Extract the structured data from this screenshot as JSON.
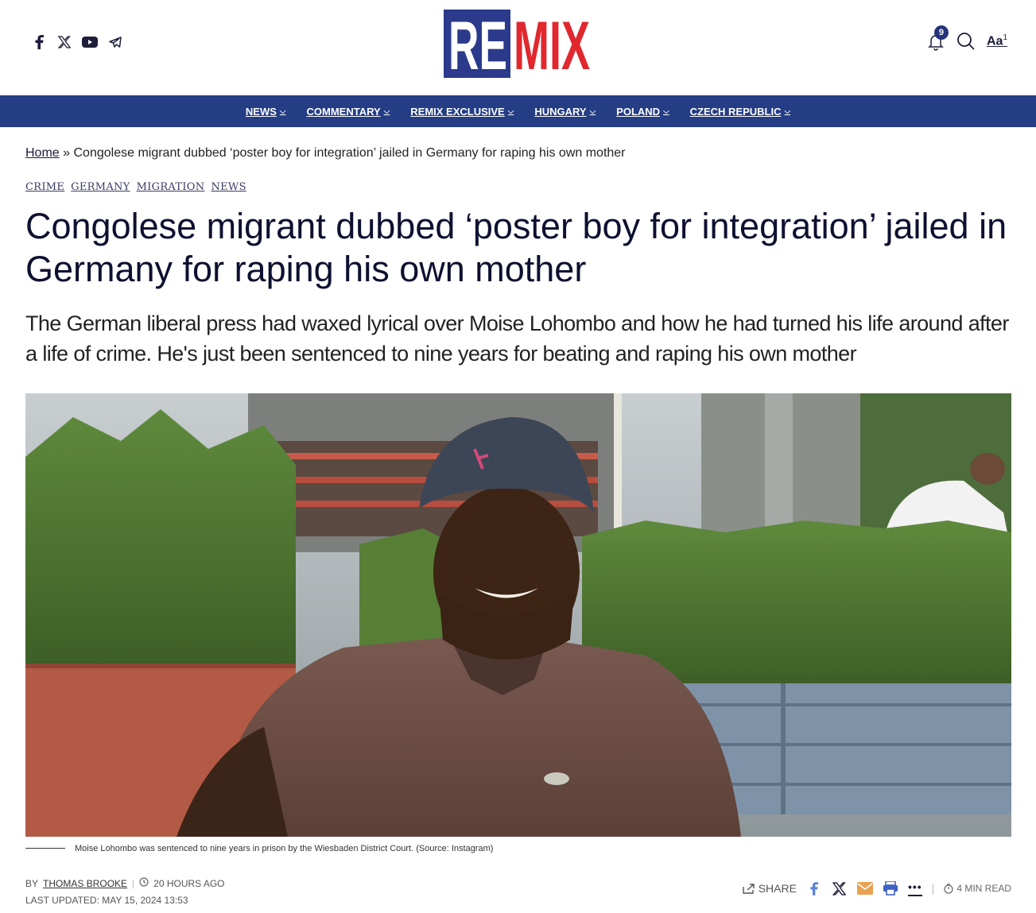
{
  "header": {
    "logo_left": "RE",
    "logo_right": "MIX",
    "notification_count": "9",
    "font_size_label": "Aa",
    "font_size_sup": "1"
  },
  "nav": [
    {
      "label": "NEWS"
    },
    {
      "label": "COMMENTARY"
    },
    {
      "label": "REMIX EXCLUSIVE"
    },
    {
      "label": "HUNGARY"
    },
    {
      "label": "POLAND"
    },
    {
      "label": "CZECH REPUBLIC"
    }
  ],
  "breadcrumb": {
    "home": "Home",
    "separator": "»",
    "current": "Congolese migrant dubbed ‘poster boy for integration’ jailed in Germany for raping his own mother"
  },
  "categories": [
    "CRIME",
    "GERMANY",
    "MIGRATION",
    "NEWS"
  ],
  "article": {
    "title": "Congolese migrant dubbed ‘poster boy for integration’ jailed in Germany for raping his own mother",
    "subtitle": "The German liberal press had waxed lyrical over Moise Lohombo and how he had turned his life around after a life of crime. He's just been sentenced to nine years for beating and raping his own mother",
    "caption": "Moise Lohombo was sentenced to nine years in prison by the Wiesbaden District Court. (Source: Instagram)"
  },
  "meta": {
    "by": "BY",
    "author": "THOMAS BROOKE",
    "separator": "|",
    "time_ago": "20 HOURS AGO",
    "last_updated": "LAST UPDATED: MAY 15, 2024 13:53"
  },
  "share": {
    "label": "SHARE",
    "more": "•••",
    "read_time": "4 MIN READ"
  },
  "colors": {
    "brand_blue": "#243d84",
    "brand_red": "#e0282e"
  }
}
